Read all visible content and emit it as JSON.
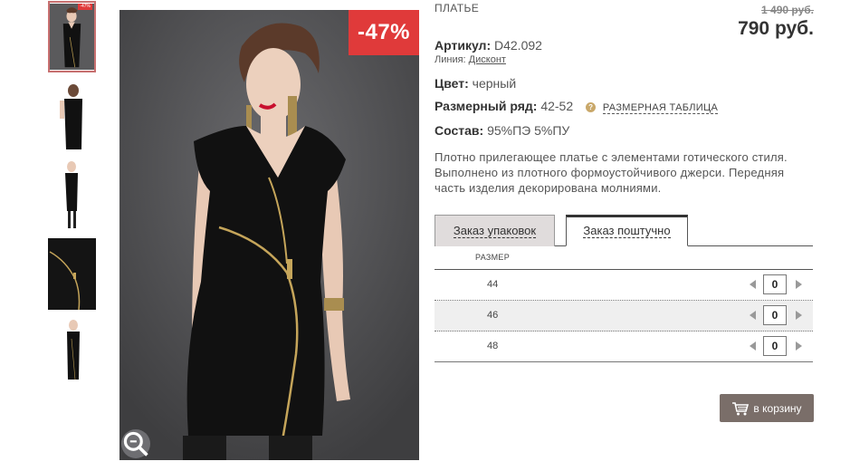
{
  "thumbnails": {
    "badge": "-47%",
    "items": [
      {
        "name": "front-view"
      },
      {
        "name": "back-view"
      },
      {
        "name": "side-view"
      },
      {
        "name": "zipper-detail"
      },
      {
        "name": "full-length"
      }
    ]
  },
  "main_image": {
    "discount_badge": "-47%",
    "zoom_icon": "magnifier-icon"
  },
  "product": {
    "type": "ПЛАТЬЕ",
    "price_old": "1 490 руб.",
    "price_new": "790 руб.",
    "article_label": "Артикул:",
    "article_value": "D42.092",
    "line_label": "Линия:",
    "line_value": "Дисконт",
    "color_label": "Цвет:",
    "color_value": "черный",
    "size_range_label": "Размерный ряд:",
    "size_range_value": "42-52",
    "size_chart_link": "РАЗМЕРНАЯ ТАБЛИЦА",
    "composition_label": "Состав:",
    "composition_value": "95%ПЭ 5%ПУ",
    "description": "Плотно прилегающее  платье с элементами готического стиля. Выполнено из плотного формоустойчивого джерси. Передняя часть изделия декорирована молниями."
  },
  "tabs": {
    "pack_order": "Заказ упаковок",
    "single_order": "Заказ поштучно"
  },
  "size_table": {
    "header": "РАЗМЕР",
    "rows": [
      {
        "size": "44",
        "qty": "0"
      },
      {
        "size": "46",
        "qty": "0"
      },
      {
        "size": "48",
        "qty": "0"
      }
    ]
  },
  "cart": {
    "label": "в корзину",
    "icon": "cart-icon"
  },
  "colors": {
    "accent": "#e03a3a",
    "button": "#7a6e69",
    "link_icon": "#c9a86a"
  }
}
